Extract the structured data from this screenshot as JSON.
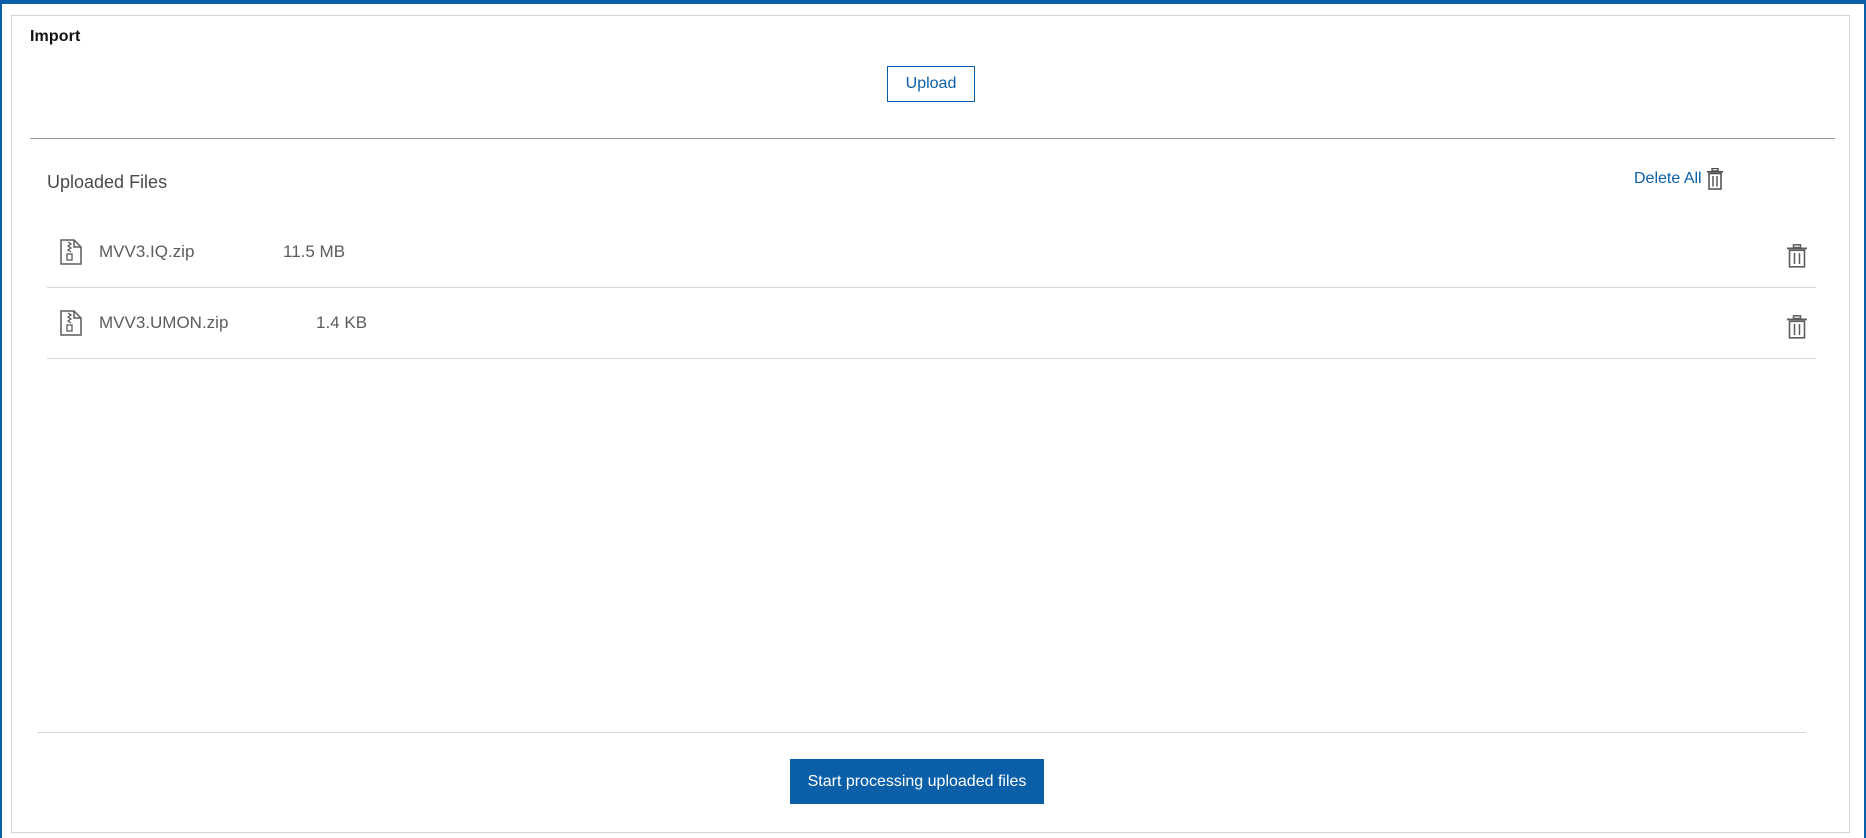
{
  "panel": {
    "title": "Import"
  },
  "upload": {
    "label": "Upload"
  },
  "uploaded_files": {
    "title": "Uploaded Files",
    "delete_all_label": "Delete All",
    "files": [
      {
        "name": "MVV3.IQ.zip",
        "size": "11.5 MB",
        "icon": "zip-file-icon"
      },
      {
        "name": "MVV3.UMON.zip",
        "size": "1.4 KB",
        "icon": "zip-file-icon"
      }
    ]
  },
  "actions": {
    "start_label": "Start processing uploaded files"
  },
  "colors": {
    "accent": "#0a5fa8",
    "text_muted": "#5c5c5c",
    "divider": "#d8d8d8"
  },
  "icons": {
    "delete": "trash-icon",
    "file": "zip-file-icon"
  }
}
